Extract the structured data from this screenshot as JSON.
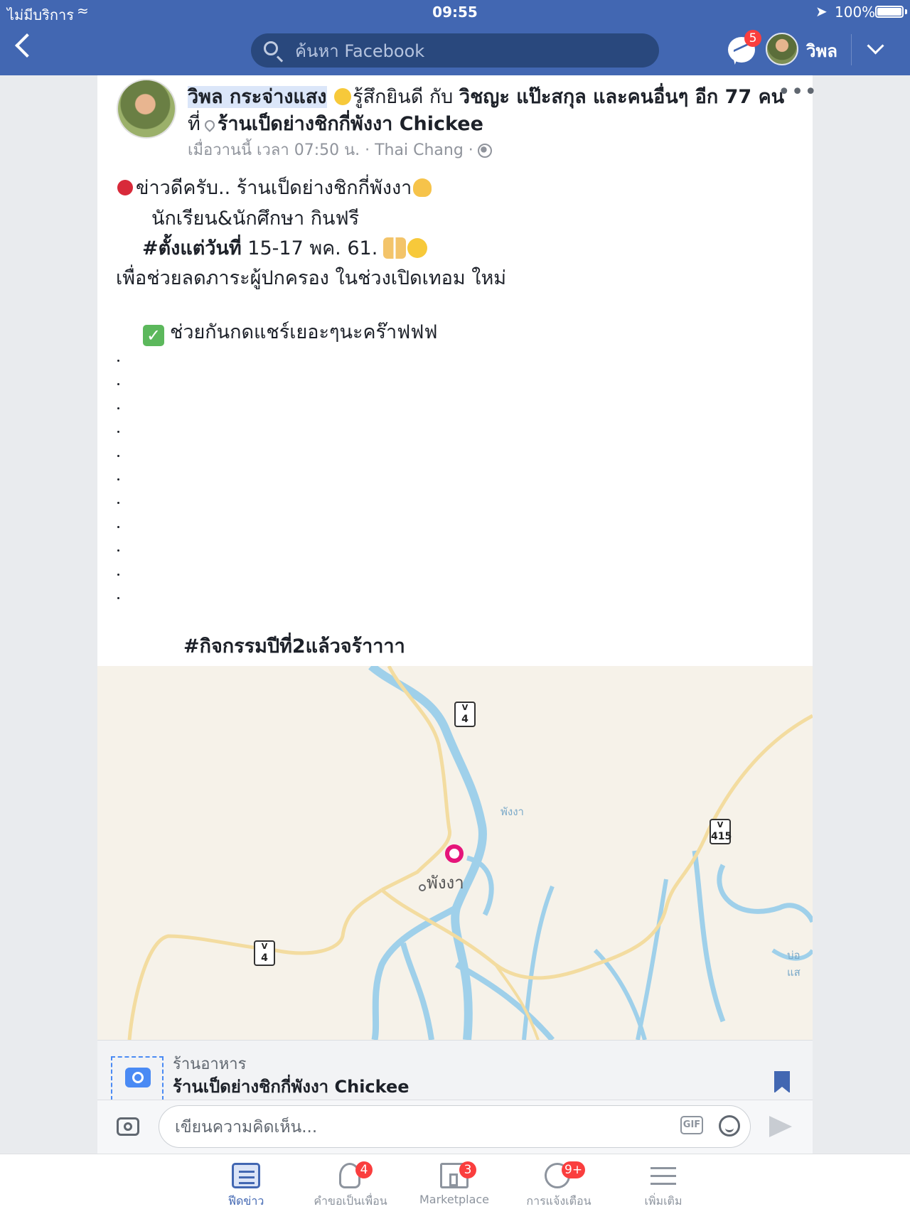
{
  "status_bar": {
    "carrier": "ไม่มีบริการ",
    "time": "09:55",
    "battery": "100%"
  },
  "header": {
    "search_placeholder": "ค้นหา Facebook",
    "messenger_badge": "5",
    "profile_name": "วิพล"
  },
  "post": {
    "author": "วิพล กระจ่างแสง",
    "feeling": "รู้สึกยินดี กับ",
    "with_text": "วิชญะ แป๊ะสกุล และคนอื่นๆ อีก 77 คน",
    "at_prefix": "ที่",
    "place": "ร้านเป็ดย่างชิกกี่พังงา Chickee",
    "timestamp": "เมื่อวานนี้ เวลา 07:50 น. · Thai Chang ·",
    "more": "•••",
    "lines": {
      "l1": "ข่าวดีครับ..  ร้านเป็ดย่างชิกกี่พังงา",
      "l2": "นักเรียน&นักศึกษา   กินฟรี",
      "l3_bold": "#ตั้งแต่วันที่",
      "l3_rest": " 15-17 พค. 61.",
      "l4": "เพื่อช่วยลดภาระผู้ปกครอง ในช่วงเปิดเทอม ใหม่",
      "l5": "ช่วยกันกดแชร์เยอะๆนะคร๊าฟฟฟ",
      "l6": "#กิจกรรมปีที่2แล้วจร้าาาา"
    }
  },
  "map": {
    "town_label": "พังงา",
    "river_label": "พังงา",
    "edge_label": "บ่อแส",
    "shields": [
      "4",
      "415",
      "4"
    ]
  },
  "place_card": {
    "category": "ร้านอาหาร",
    "name": "ร้านเป็ดย่างชิกกี่พังงา Chickee"
  },
  "comment": {
    "placeholder": "เขียนความคิดเห็น...",
    "gif": "GIF"
  },
  "tabs": [
    {
      "label": "ฟีดข่าว",
      "badge": ""
    },
    {
      "label": "คำขอเป็นเพื่อน",
      "badge": "4"
    },
    {
      "label": "Marketplace",
      "badge": "3"
    },
    {
      "label": "การแจ้งเตือน",
      "badge": "9+"
    },
    {
      "label": "เพิ่มเติม",
      "badge": ""
    }
  ],
  "colors": {
    "brand": "#4267b2",
    "badge": "#fa3e3e",
    "map_pin": "#e5157a"
  }
}
